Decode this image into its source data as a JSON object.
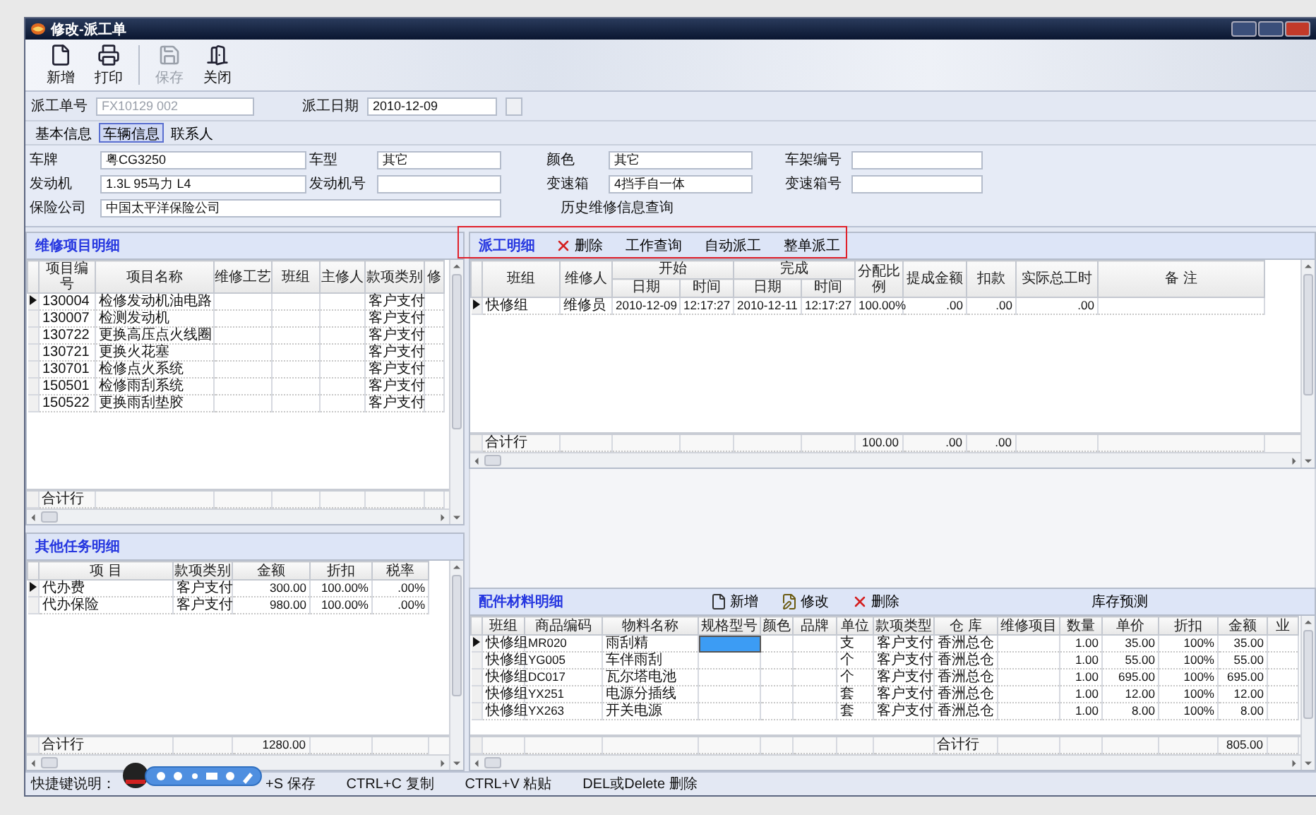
{
  "window": {
    "title": "修改-派工单"
  },
  "toolbar": [
    {
      "label": "新增",
      "kind": "new",
      "disabled": false
    },
    {
      "label": "打印",
      "kind": "print",
      "disabled": false
    },
    {
      "label": "保存",
      "kind": "save",
      "disabled": true
    },
    {
      "label": "关闭",
      "kind": "exit",
      "disabled": false
    }
  ],
  "order_fields": [
    {
      "label": "派工单号",
      "value": "FX10129 002",
      "kind": "text",
      "disabled": true
    },
    {
      "label": "派工日期",
      "value": "2010-12-09",
      "kind": "date",
      "disabled": false
    }
  ],
  "tabs": [
    {
      "label": "基本信息",
      "selected": false
    },
    {
      "label": "车辆信息",
      "selected": true
    },
    {
      "label": "联系人",
      "selected": false
    }
  ],
  "vehicle": {
    "fields": [
      {
        "label": "车牌",
        "value": "粤CG3250"
      },
      {
        "label": "车型",
        "value": "其它"
      },
      {
        "label": "颜色",
        "value": "其它"
      },
      {
        "label": "车架编号"
      },
      {
        "label": "发动机",
        "value": "1.3L 95马力 L4"
      },
      {
        "label": "发动机号"
      },
      {
        "label": "变速箱",
        "value": "4挡手自一体"
      },
      {
        "label": "变速箱号"
      },
      {
        "label": "保险公司",
        "value": "中国太平洋保险公司",
        "wide": true
      }
    ],
    "link": "历史维修信息查询"
  },
  "repair_items": {
    "title": "维修项目明细",
    "columns": [
      {
        "label": "项目编号"
      },
      {
        "label": "项目名称"
      },
      {
        "label": "维修工艺"
      },
      {
        "label": "班组"
      },
      {
        "label": "主修人"
      },
      {
        "label": "款项类别"
      },
      {
        "label": "修"
      }
    ],
    "rows": [
      {
        "selected": true,
        "cells": {
          "0": "130004",
          "1": "检修发动机油电路",
          "5": "客户支付"
        }
      },
      {
        "selected": false,
        "cells": {
          "0": "130007",
          "1": "检测发动机",
          "5": "客户支付"
        }
      },
      {
        "selected": false,
        "cells": {
          "0": "130722",
          "1": "更换高压点火线圈",
          "5": "客户支付"
        }
      },
      {
        "selected": false,
        "cells": {
          "0": "130721",
          "1": "更换火花塞",
          "5": "客户支付"
        }
      },
      {
        "selected": false,
        "cells": {
          "0": "130701",
          "1": "检修点火系统",
          "5": "客户支付"
        }
      },
      {
        "selected": false,
        "cells": {
          "0": "150501",
          "1": "检修雨刮系统",
          "5": "客户支付"
        }
      },
      {
        "selected": false,
        "cells": {
          "0": "150522",
          "1": "更换雨刮垫胶",
          "5": "客户支付"
        }
      }
    ],
    "total": {
      "0": "合计行"
    }
  },
  "other_tasks": {
    "title": "其他任务明细",
    "columns": [
      {
        "label": "项 目"
      },
      {
        "label": "款项类别"
      },
      {
        "label": "金额"
      },
      {
        "label": "折扣"
      },
      {
        "label": "税率"
      }
    ],
    "rows": [
      {
        "selected": true,
        "cells": {
          "0": "代办费",
          "1": "客户支付",
          "2": "300.00",
          "3": "100.00%",
          "4": ".00%"
        }
      },
      {
        "selected": false,
        "cells": {
          "0": "代办保险",
          "1": "客户支付",
          "2": "980.00",
          "3": "100.00%",
          "4": ".00%"
        }
      }
    ],
    "total": {
      "0": "合计行",
      "2": "1280.00"
    }
  },
  "dispatch": {
    "title": "派工明细",
    "actions": [
      {
        "label": "删除",
        "kind": "delete"
      },
      {
        "label": "工作查询",
        "kind": "text"
      },
      {
        "label": "自动派工",
        "kind": "text"
      },
      {
        "label": "整单派工",
        "kind": "text"
      }
    ],
    "columns": [
      {
        "label": "班组"
      },
      {
        "label": "维修人"
      },
      {
        "label": "开始",
        "children": [
          {
            "label": "日期"
          },
          {
            "label": "时间"
          }
        ]
      },
      {
        "label": "完成",
        "children": [
          {
            "label": "日期"
          },
          {
            "label": "时间"
          }
        ]
      },
      {
        "label": "分配比例"
      },
      {
        "label": "提成金额"
      },
      {
        "label": "扣款"
      },
      {
        "label": "实际总工时"
      },
      {
        "label": "备 注"
      }
    ],
    "rows": [
      {
        "selected": true,
        "cells": {
          "0": "快修组",
          "1": "维修员",
          "2": "2010-12-09",
          "3": "12:17:27",
          "4": "2010-12-11",
          "5": "12:17:27",
          "6": "100.00%",
          "7": ".00",
          "8": ".00",
          "9": ".00"
        }
      }
    ],
    "total": {
      "0": "合计行",
      "6": "100.00",
      "7": ".00",
      "8": ".00"
    }
  },
  "parts": {
    "title": "配件材料明细",
    "actions": [
      {
        "label": "新增",
        "kind": "new"
      },
      {
        "label": "修改",
        "kind": "edit"
      },
      {
        "label": "删除",
        "kind": "delete"
      }
    ],
    "forecast": "库存预测",
    "columns": [
      {
        "label": "班组",
        "focused": false
      },
      {
        "label": "商品编码",
        "focused": false
      },
      {
        "label": "物料名称",
        "focused": false
      },
      {
        "label": "规格型号",
        "focused": true
      },
      {
        "label": "颜色",
        "focused": false
      },
      {
        "label": "品牌",
        "focused": false
      },
      {
        "label": "单位",
        "focused": false
      },
      {
        "label": "款项类型",
        "focused": false
      },
      {
        "label": "仓 库",
        "focused": false
      },
      {
        "label": "维修项目",
        "focused": false
      },
      {
        "label": "数量",
        "focused": false
      },
      {
        "label": "单价",
        "focused": false
      },
      {
        "label": "折扣",
        "focused": false
      },
      {
        "label": "金额",
        "focused": false
      },
      {
        "label": "业",
        "focused": false
      }
    ],
    "rows": [
      {
        "selected": true,
        "cells": {
          "0": "快修组",
          "1": "MR020",
          "2": "雨刮精",
          "6": "支",
          "7": "客户支付",
          "8": "香洲总仓",
          "10": "1.00",
          "11": "35.00",
          "12": "100%",
          "13": "35.00"
        }
      },
      {
        "selected": false,
        "cells": {
          "0": "快修组",
          "1": "YG005",
          "2": "车伴雨刮",
          "6": "个",
          "7": "客户支付",
          "8": "香洲总仓",
          "10": "1.00",
          "11": "55.00",
          "12": "100%",
          "13": "55.00"
        }
      },
      {
        "selected": false,
        "cells": {
          "0": "快修组",
          "1": "DC017",
          "2": "瓦尔塔电池",
          "6": "个",
          "7": "客户支付",
          "8": "香洲总仓",
          "10": "1.00",
          "11": "695.00",
          "12": "100%",
          "13": "695.00"
        }
      },
      {
        "selected": false,
        "cells": {
          "0": "快修组",
          "1": "YX251",
          "2": "电源分插线",
          "6": "套",
          "7": "客户支付",
          "8": "香洲总仓",
          "10": "1.00",
          "11": "12.00",
          "12": "100%",
          "13": "12.00"
        }
      },
      {
        "selected": false,
        "cells": {
          "0": "快修组",
          "1": "YX263",
          "2": "开关电源",
          "6": "套",
          "7": "客户支付",
          "8": "香洲总仓",
          "10": "1.00",
          "11": "8.00",
          "12": "100%",
          "13": "8.00"
        }
      }
    ],
    "total": {
      "8": "合计行",
      "13": "805.00"
    }
  },
  "status_bar": {
    "label": "快捷键说明：",
    "shortcuts": [
      "+S 保存",
      "CTRL+C 复制",
      "CTRL+V 粘贴",
      "DEL或Delete 删除"
    ]
  }
}
